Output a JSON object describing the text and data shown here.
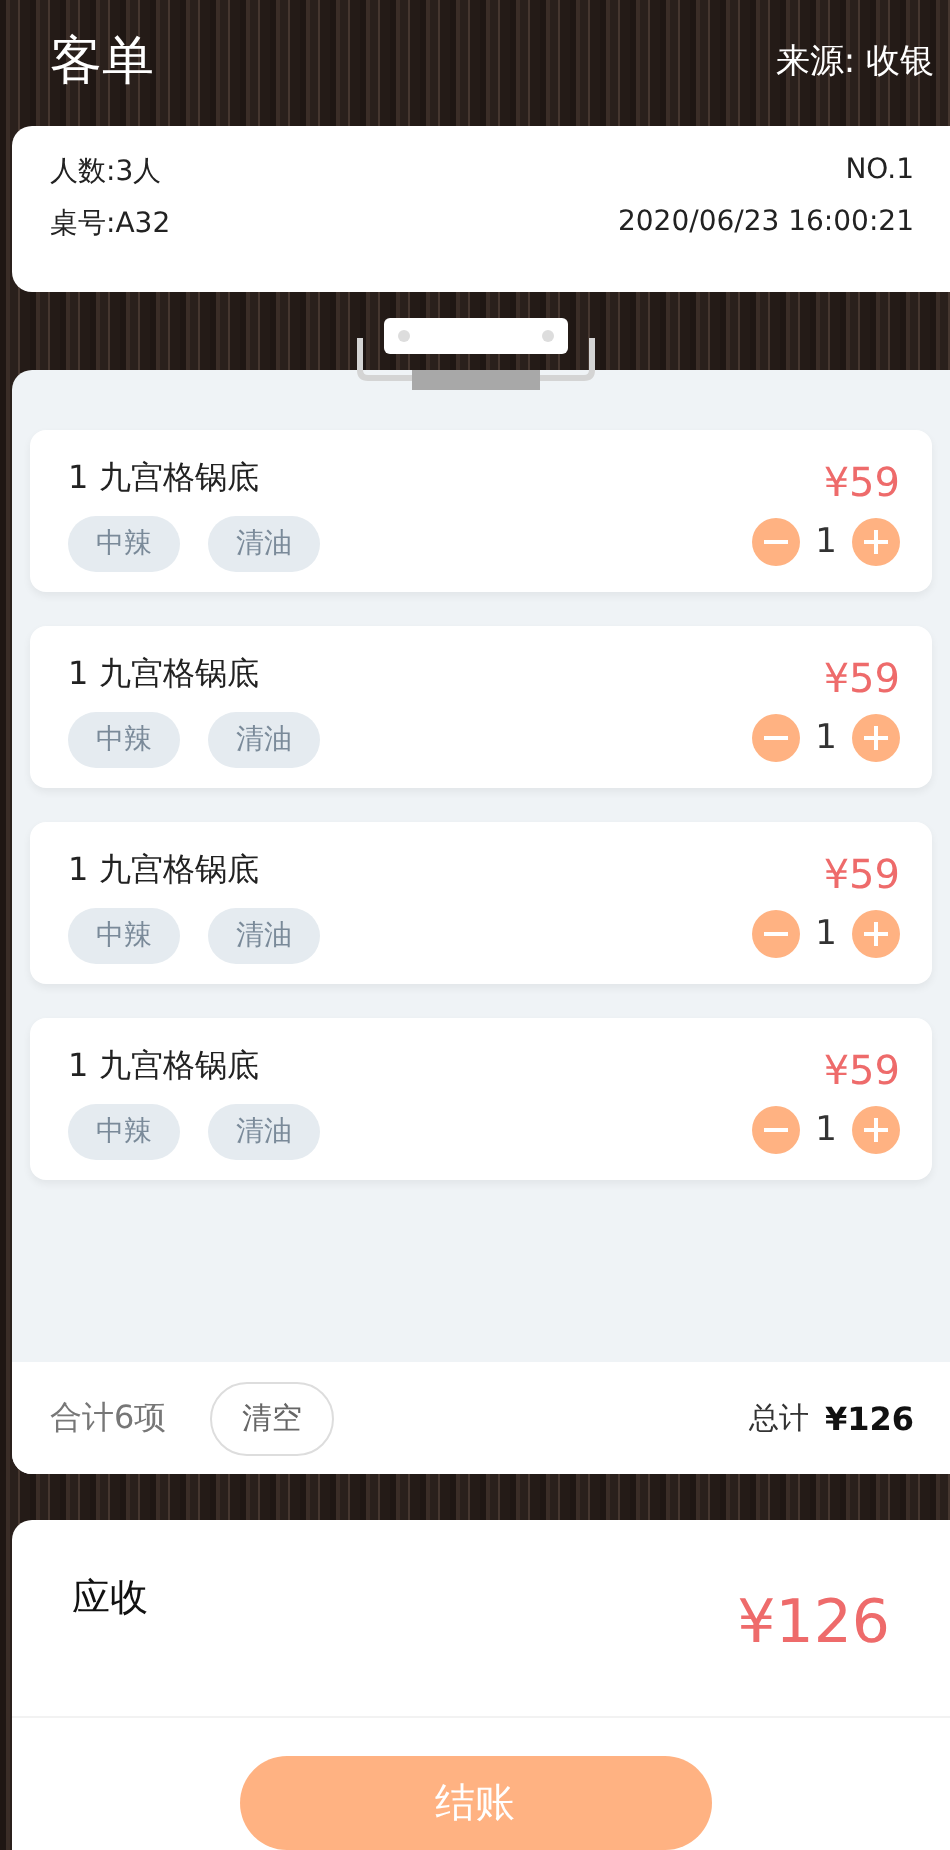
{
  "header": {
    "title": "客单",
    "source": "来源: 收银"
  },
  "info": {
    "guests": "人数:3人",
    "order_no": "NO.1",
    "table": "桌号:A32",
    "time": "2020/06/23 16:00:21"
  },
  "items": [
    {
      "name": "1 九宫格锅底",
      "price": "¥59",
      "tags": [
        "中辣",
        "清油"
      ],
      "quantity": "1"
    },
    {
      "name": "1 九宫格锅底",
      "price": "¥59",
      "tags": [
        "中辣",
        "清油"
      ],
      "quantity": "1"
    },
    {
      "name": "1 九宫格锅底",
      "price": "¥59",
      "tags": [
        "中辣",
        "清油"
      ],
      "quantity": "1"
    },
    {
      "name": "1 九宫格锅底",
      "price": "¥59",
      "tags": [
        "中辣",
        "清油"
      ],
      "quantity": "1"
    }
  ],
  "footer": {
    "count": "合计6项",
    "clear": "清空",
    "total_label": "总计",
    "total": "¥126"
  },
  "receivable": {
    "label": "应收",
    "amount": "¥126"
  },
  "checkout": "结账"
}
